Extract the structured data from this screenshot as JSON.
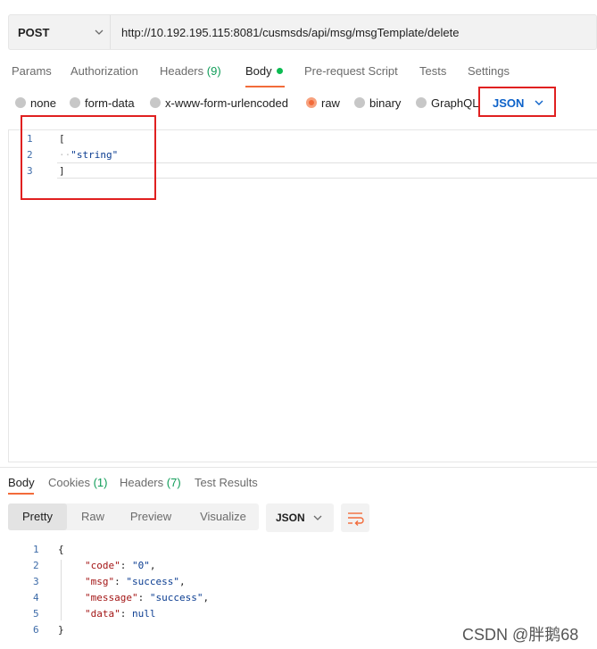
{
  "request": {
    "method": "POST",
    "url": "http://10.192.195.115:8081/cusmsds/api/msg/msgTemplate/delete"
  },
  "request_tabs": {
    "params": "Params",
    "authorization": "Authorization",
    "headers": "Headers",
    "headers_count": "(9)",
    "body": "Body",
    "prerequest": "Pre-request Script",
    "tests": "Tests",
    "settings": "Settings"
  },
  "body_types": {
    "none": "none",
    "form_data": "form-data",
    "urlencoded": "x-www-form-urlencoded",
    "raw": "raw",
    "binary": "binary",
    "graphql": "GraphQL",
    "selected": "raw"
  },
  "raw_language": "JSON",
  "request_body": {
    "line_numbers": [
      "1",
      "2",
      "3"
    ],
    "lines": [
      "[",
      "\"string\"",
      "]"
    ]
  },
  "response_tabs": {
    "body": "Body",
    "cookies": "Cookies",
    "cookies_count": "(1)",
    "headers": "Headers",
    "headers_count": "(7)",
    "test_results": "Test Results"
  },
  "response_views": {
    "pretty": "Pretty",
    "raw": "Raw",
    "preview": "Preview",
    "visualize": "Visualize",
    "selected": "Pretty"
  },
  "response_format": "JSON",
  "response_body": {
    "line_numbers": [
      "1",
      "2",
      "3",
      "4",
      "5",
      "6"
    ],
    "open": "{",
    "close": "}",
    "fields": [
      {
        "key": "\"code\"",
        "value": "\"0\"",
        "sep": ","
      },
      {
        "key": "\"msg\"",
        "value": "\"success\"",
        "sep": ","
      },
      {
        "key": "\"message\"",
        "value": "\"success\"",
        "sep": ","
      },
      {
        "key": "\"data\"",
        "value": "null",
        "sep": ""
      }
    ]
  },
  "watermark": "CSDN @胖鹅68",
  "colors": {
    "accent": "#f26b3a",
    "highlight_box": "#e02020",
    "count_green": "#0f9d58",
    "link_blue": "#0d62c9"
  }
}
